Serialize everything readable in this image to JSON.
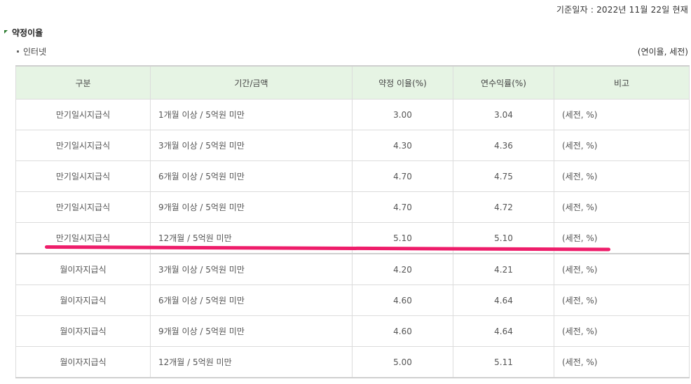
{
  "header": {
    "reference_date": "기준일자 : 2022년 11월 22일 현재"
  },
  "section": {
    "title": "약정이율",
    "subtitle": "인터넷",
    "unit_note": "(연이율, 세전)"
  },
  "table": {
    "headers": [
      "구분",
      "기간/금액",
      "약정 이율(%)",
      "연수익률(%)",
      "비고"
    ],
    "rows": [
      {
        "type": "만기일시지급식",
        "period": "1개월 이상 / 5억원 미만",
        "rate": "3.00",
        "yield": "3.04",
        "note": "(세전, %)"
      },
      {
        "type": "만기일시지급식",
        "period": "3개월 이상 / 5억원 미만",
        "rate": "4.30",
        "yield": "4.36",
        "note": "(세전, %)"
      },
      {
        "type": "만기일시지급식",
        "period": "6개월 이상 / 5억원 미만",
        "rate": "4.70",
        "yield": "4.75",
        "note": "(세전, %)"
      },
      {
        "type": "만기일시지급식",
        "period": "9개월 이상 / 5억원 미만",
        "rate": "4.70",
        "yield": "4.72",
        "note": "(세전, %)"
      },
      {
        "type": "만기일시지급식",
        "period": "12개월 / 5억원 미만",
        "rate": "5.10",
        "yield": "5.10",
        "note": "(세전, %)"
      },
      {
        "type": "월이자지급식",
        "period": "3개월 이상 / 5억원 미만",
        "rate": "4.20",
        "yield": "4.21",
        "note": "(세전, %)"
      },
      {
        "type": "월이자지급식",
        "period": "6개월 이상 / 5억원 미만",
        "rate": "4.60",
        "yield": "4.64",
        "note": "(세전, %)"
      },
      {
        "type": "월이자지급식",
        "period": "9개월 이상 / 5억원 미만",
        "rate": "4.60",
        "yield": "4.64",
        "note": "(세전, %)"
      },
      {
        "type": "월이자지급식",
        "period": "12개월 / 5억원 미만",
        "rate": "5.00",
        "yield": "5.11",
        "note": "(세전, %)"
      }
    ]
  },
  "annotation": {
    "highlight_color": "#ee1d6a",
    "header_bg_color": "#e6f4e4",
    "section_icon_color": "#2e7d32"
  }
}
